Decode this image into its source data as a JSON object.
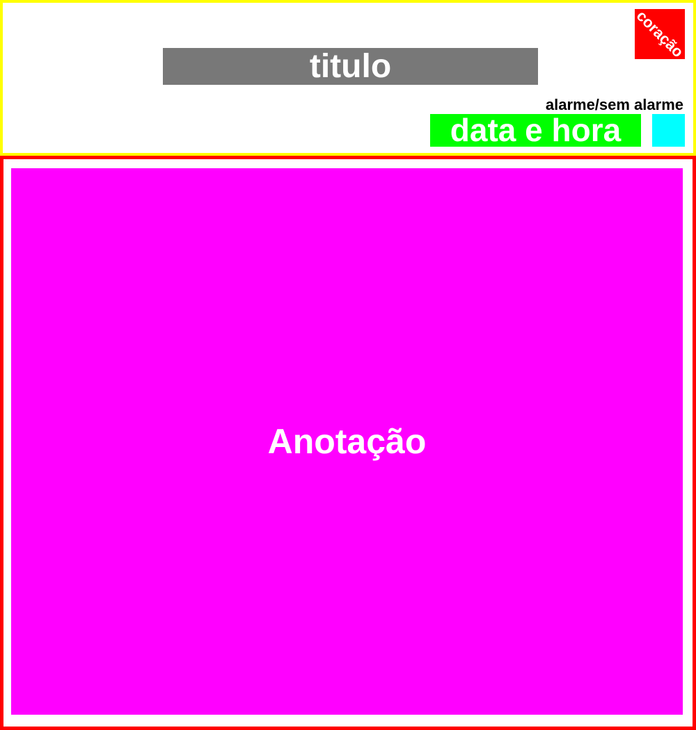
{
  "header": {
    "title": "titulo",
    "heart": "coração",
    "alarm_status": "alarme/sem alarme",
    "datetime": "data e hora"
  },
  "content": {
    "annotation": "Anotação"
  },
  "colors": {
    "header_border": "#ffff00",
    "content_border": "#ff0000",
    "title_bg": "#787878",
    "heart_bg": "#ff0000",
    "datetime_bg": "#00ff00",
    "alarm_indicator_bg": "#00ffff",
    "annotation_bg": "#ff00ff"
  }
}
